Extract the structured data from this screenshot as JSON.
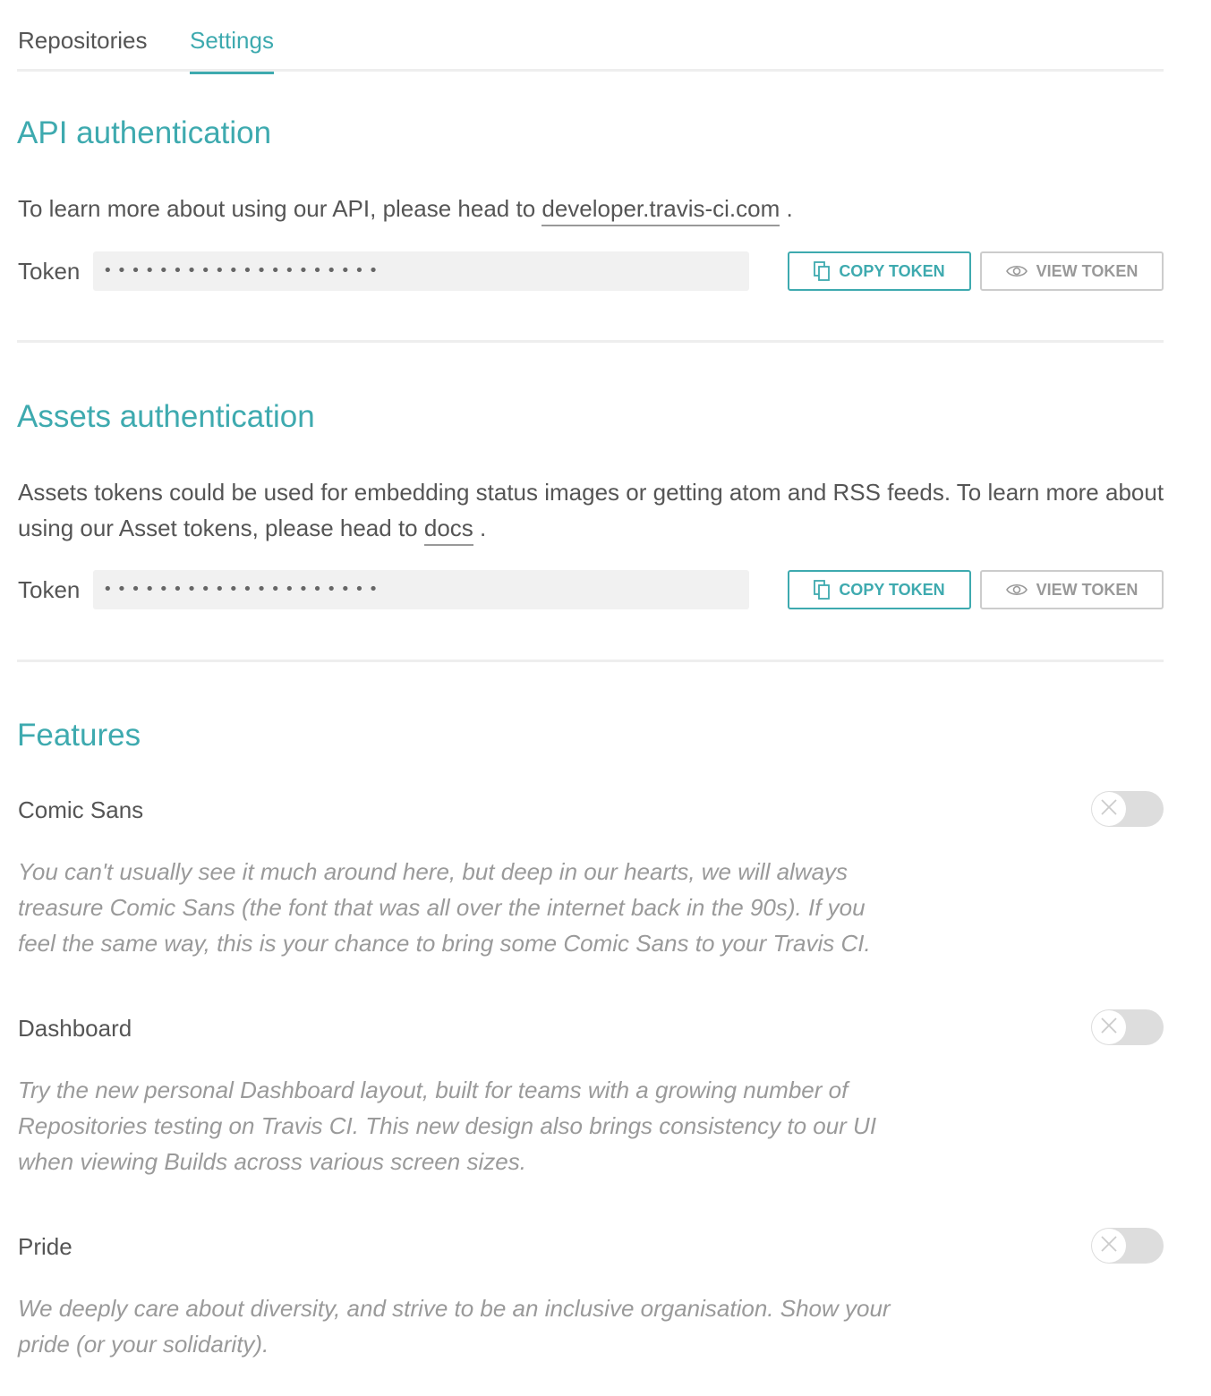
{
  "tabs": [
    {
      "label": "Repositories",
      "active": false
    },
    {
      "label": "Settings",
      "active": true
    }
  ],
  "api_auth": {
    "heading": "API authentication",
    "text_before": "To learn more about using our API, please head to ",
    "link": "developer.travis-ci.com",
    "text_after": " .",
    "token_label": "Token",
    "token_value": "••••••••••••••••••••",
    "copy_label": "COPY TOKEN",
    "view_label": "VIEW TOKEN"
  },
  "assets_auth": {
    "heading": "Assets authentication",
    "text_before": "Assets tokens could be used for embedding status images or getting atom and RSS feeds. To learn more about using our Asset tokens, please head to ",
    "link": "docs",
    "text_after": " .",
    "token_label": "Token",
    "token_value": "••••••••••••••••••••",
    "copy_label": "COPY TOKEN",
    "view_label": "VIEW TOKEN"
  },
  "features": {
    "heading": "Features",
    "items": [
      {
        "title": "Comic Sans",
        "description": "You can't usually see it much around here, but deep in our hearts, we will always treasure Comic Sans (the font that was all over the internet back in the 90s). If you feel the same way, this is your chance to bring some Comic Sans to your Travis CI.",
        "enabled": false
      },
      {
        "title": "Dashboard",
        "description": "Try the new personal Dashboard layout, built for teams with a growing number of Repositories testing on Travis CI. This new design also brings consistency to our UI when viewing Builds across various screen sizes.",
        "enabled": false
      },
      {
        "title": "Pride",
        "description": "We deeply care about diversity, and strive to be an inclusive organisation. Show your pride (or your solidarity).",
        "enabled": false
      }
    ]
  },
  "colors": {
    "accent": "#3eaaaf",
    "text": "#555555",
    "muted": "#9a9a9a",
    "divider": "#eeeeee"
  }
}
